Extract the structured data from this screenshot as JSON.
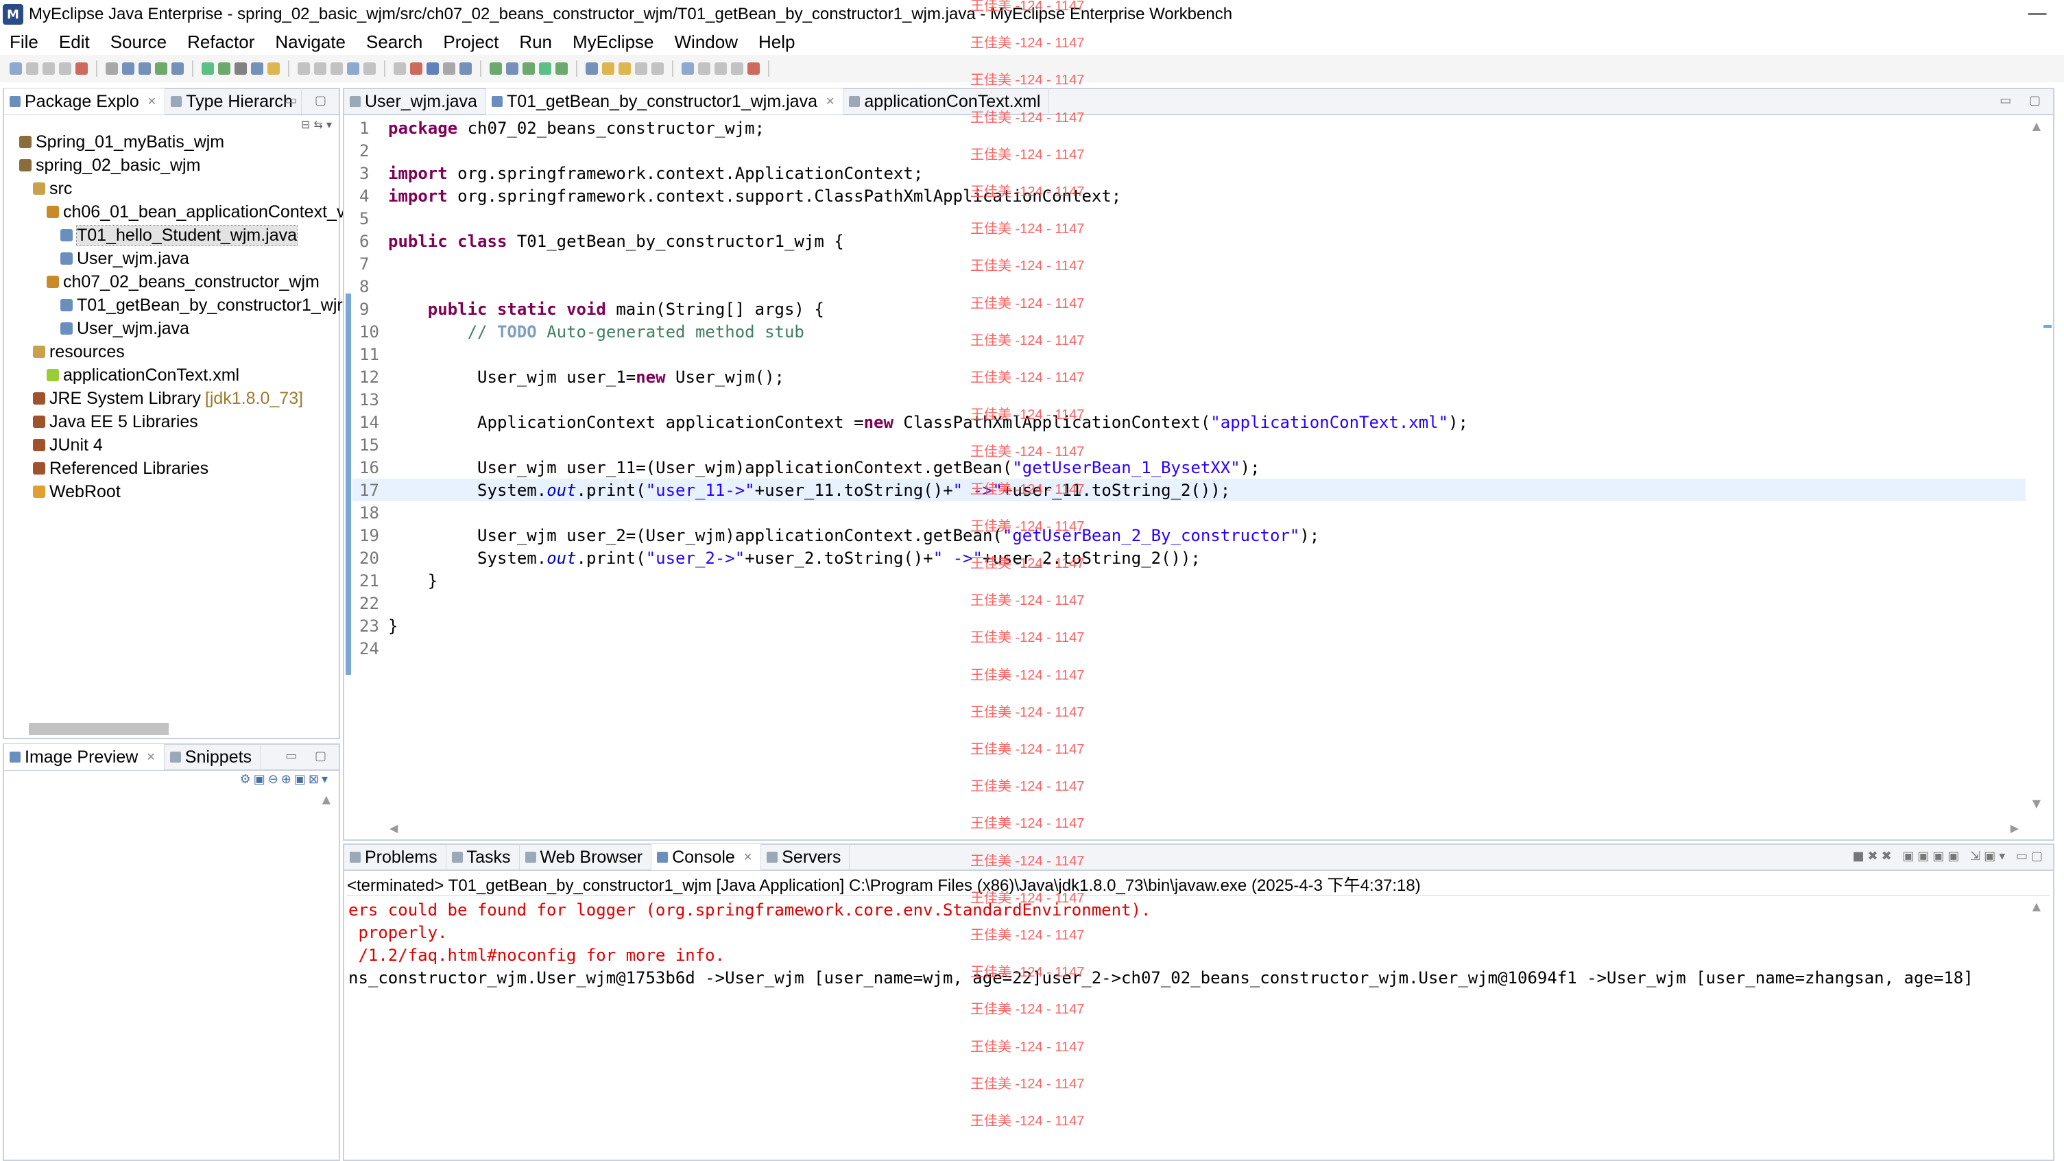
{
  "window": {
    "title": "MyEclipse Java Enterprise - spring_02_basic_wjm/src/ch07_02_beans_constructor_wjm/T01_getBean_by_constructor1_wjm.java - MyEclipse Enterprise Workbench",
    "minimize": "—"
  },
  "menu": [
    "File",
    "Edit",
    "Source",
    "Refactor",
    "Navigate",
    "Search",
    "Project",
    "Run",
    "MyEclipse",
    "Window",
    "Help"
  ],
  "explorer": {
    "tabs": [
      {
        "label": "Package Explo",
        "active": true
      },
      {
        "label": "Type Hierarch",
        "active": false
      }
    ],
    "tree": [
      {
        "label": "Spring_01_myBatis_wjm",
        "indent": 0,
        "icon": "project-icon"
      },
      {
        "label": "spring_02_basic_wjm",
        "indent": 0,
        "icon": "project-icon"
      },
      {
        "label": "src",
        "indent": 1,
        "icon": "source-folder-icon"
      },
      {
        "label": "ch06_01_bean_applicationContext_v",
        "indent": 2,
        "icon": "package-icon"
      },
      {
        "label": "T01_hello_Student_wjm.java",
        "indent": 3,
        "icon": "java-file-icon",
        "selected": true
      },
      {
        "label": "User_wjm.java",
        "indent": 3,
        "icon": "java-file-icon"
      },
      {
        "label": "ch07_02_beans_constructor_wjm",
        "indent": 2,
        "icon": "package-icon"
      },
      {
        "label": "T01_getBean_by_constructor1_wjr",
        "indent": 3,
        "icon": "java-file-icon"
      },
      {
        "label": "User_wjm.java",
        "indent": 3,
        "icon": "java-file-icon"
      },
      {
        "label": "resources",
        "indent": 1,
        "icon": "source-folder-icon"
      },
      {
        "label": "applicationConText.xml",
        "indent": 2,
        "icon": "xml-file-icon"
      },
      {
        "label": "JRE System Library",
        "extra": "[jdk1.8.0_73]",
        "indent": 1,
        "icon": "library-icon"
      },
      {
        "label": "Java EE 5 Libraries",
        "indent": 1,
        "icon": "library-icon"
      },
      {
        "label": "JUnit 4",
        "indent": 1,
        "icon": "library-icon"
      },
      {
        "label": "Referenced Libraries",
        "indent": 1,
        "icon": "library-icon"
      },
      {
        "label": "WebRoot",
        "indent": 1,
        "icon": "folder-icon"
      }
    ]
  },
  "preview": {
    "tabs": [
      {
        "label": "Image Preview",
        "active": true
      },
      {
        "label": "Snippets",
        "active": false
      }
    ]
  },
  "editor": {
    "tabs": [
      {
        "label": "User_wjm.java",
        "active": false
      },
      {
        "label": "T01_getBean_by_constructor1_wjm.java",
        "active": true
      },
      {
        "label": "applicationConText.xml",
        "active": false
      }
    ],
    "lines": [
      {
        "n": "1",
        "code": [
          {
            "t": "package",
            "c": "kw"
          },
          {
            "t": " ch07_02_beans_constructor_wjm;"
          }
        ]
      },
      {
        "n": "2",
        "code": []
      },
      {
        "n": "3",
        "code": [
          {
            "t": "import",
            "c": "kw"
          },
          {
            "t": " org.springframework.context.ApplicationContext;"
          }
        ]
      },
      {
        "n": "4",
        "code": [
          {
            "t": "import",
            "c": "kw"
          },
          {
            "t": " org.springframework.context.support.ClassPathXmlApplicationContext;"
          }
        ]
      },
      {
        "n": "5",
        "code": []
      },
      {
        "n": "6",
        "code": [
          {
            "t": "public class",
            "c": "kw"
          },
          {
            "t": " T01_getBean_by_constructor1_wjm {"
          }
        ]
      },
      {
        "n": "7",
        "code": []
      },
      {
        "n": "8",
        "code": []
      },
      {
        "n": "9",
        "code": [
          {
            "t": "    "
          },
          {
            "t": "public static void",
            "c": "kw"
          },
          {
            "t": " main(String[] args) {"
          }
        ]
      },
      {
        "n": "10",
        "code": [
          {
            "t": "        "
          },
          {
            "t": "// ",
            "c": "cm"
          },
          {
            "t": "TODO",
            "c": "todo"
          },
          {
            "t": " Auto-generated method stub",
            "c": "cm"
          }
        ]
      },
      {
        "n": "11",
        "code": []
      },
      {
        "n": "12",
        "code": [
          {
            "t": "         User_wjm user_1="
          },
          {
            "t": "new",
            "c": "kw"
          },
          {
            "t": " User_wjm();"
          }
        ]
      },
      {
        "n": "13",
        "code": []
      },
      {
        "n": "14",
        "code": [
          {
            "t": "         ApplicationContext applicationContext ="
          },
          {
            "t": "new",
            "c": "kw"
          },
          {
            "t": " ClassPathXmlApplicationContext("
          },
          {
            "t": "\"applicationConText.xml\"",
            "c": "str"
          },
          {
            "t": ");"
          }
        ]
      },
      {
        "n": "15",
        "code": []
      },
      {
        "n": "16",
        "code": [
          {
            "t": "         User_wjm user_11=(User_wjm)applicationContext.getBean("
          },
          {
            "t": "\"getUserBean_1_BysetXX\"",
            "c": "str"
          },
          {
            "t": ");"
          }
        ]
      },
      {
        "n": "17",
        "code": [
          {
            "t": "         System."
          },
          {
            "t": "out",
            "c": "field"
          },
          {
            "t": ".print("
          },
          {
            "t": "\"user_11->\"",
            "c": "str"
          },
          {
            "t": "+user_11.toString()+"
          },
          {
            "t": "\" ->\"",
            "c": "str"
          },
          {
            "t": "+user_11.toString_2());"
          }
        ],
        "highlight": true
      },
      {
        "n": "18",
        "code": []
      },
      {
        "n": "19",
        "code": [
          {
            "t": "         User_wjm user_2=(User_wjm)applicationContext.getBean("
          },
          {
            "t": "\"getUserBean_2_By_constructor\"",
            "c": "str"
          },
          {
            "t": ");"
          }
        ]
      },
      {
        "n": "20",
        "code": [
          {
            "t": "         System."
          },
          {
            "t": "out",
            "c": "field"
          },
          {
            "t": ".print("
          },
          {
            "t": "\"user_2->\"",
            "c": "str"
          },
          {
            "t": "+user_2.toString()+"
          },
          {
            "t": "\" ->\"",
            "c": "str"
          },
          {
            "t": "+user_2.toString_2());"
          }
        ]
      },
      {
        "n": "21",
        "code": [
          {
            "t": "    }"
          }
        ]
      },
      {
        "n": "22",
        "code": []
      },
      {
        "n": "23",
        "code": [
          {
            "t": "}"
          }
        ]
      },
      {
        "n": "24",
        "code": []
      }
    ]
  },
  "bottom": {
    "tabs": [
      {
        "label": "Problems",
        "active": false
      },
      {
        "label": "Tasks",
        "active": false
      },
      {
        "label": "Web Browser",
        "active": false
      },
      {
        "label": "Console",
        "active": true
      },
      {
        "label": "Servers",
        "active": false
      }
    ],
    "status": "<terminated> T01_getBean_by_constructor1_wjm [Java Application] C:\\Program Files (x86)\\Java\\jdk1.8.0_73\\bin\\javaw.exe (2025-4-3 下午4:37:18)",
    "lines": [
      {
        "text": "ers could be found for logger (org.springframework.core.env.StandardEnvironment).",
        "c": "err"
      },
      {
        "text": " properly.",
        "c": "err"
      },
      {
        "text": " /1.2/faq.html#noconfig for more info.",
        "c": "err"
      },
      {
        "text": "ns_constructor_wjm.User_wjm@1753b6d ->User_wjm [user_name=wjm, age=22]user_2->ch07_02_beans_constructor_wjm.User_wjm@10694f1 ->User_wjm [user_name=zhangsan, age=18]",
        "c": ""
      }
    ]
  },
  "watermark": {
    "text": "王佳美 -124 - 1147",
    "color": "#ff5050"
  },
  "colors": {
    "keyword": "#7f0055",
    "string": "#2a00ff",
    "comment": "#3f7f5f",
    "error": "#e00000",
    "line_highlight": "#e8f2fe"
  }
}
